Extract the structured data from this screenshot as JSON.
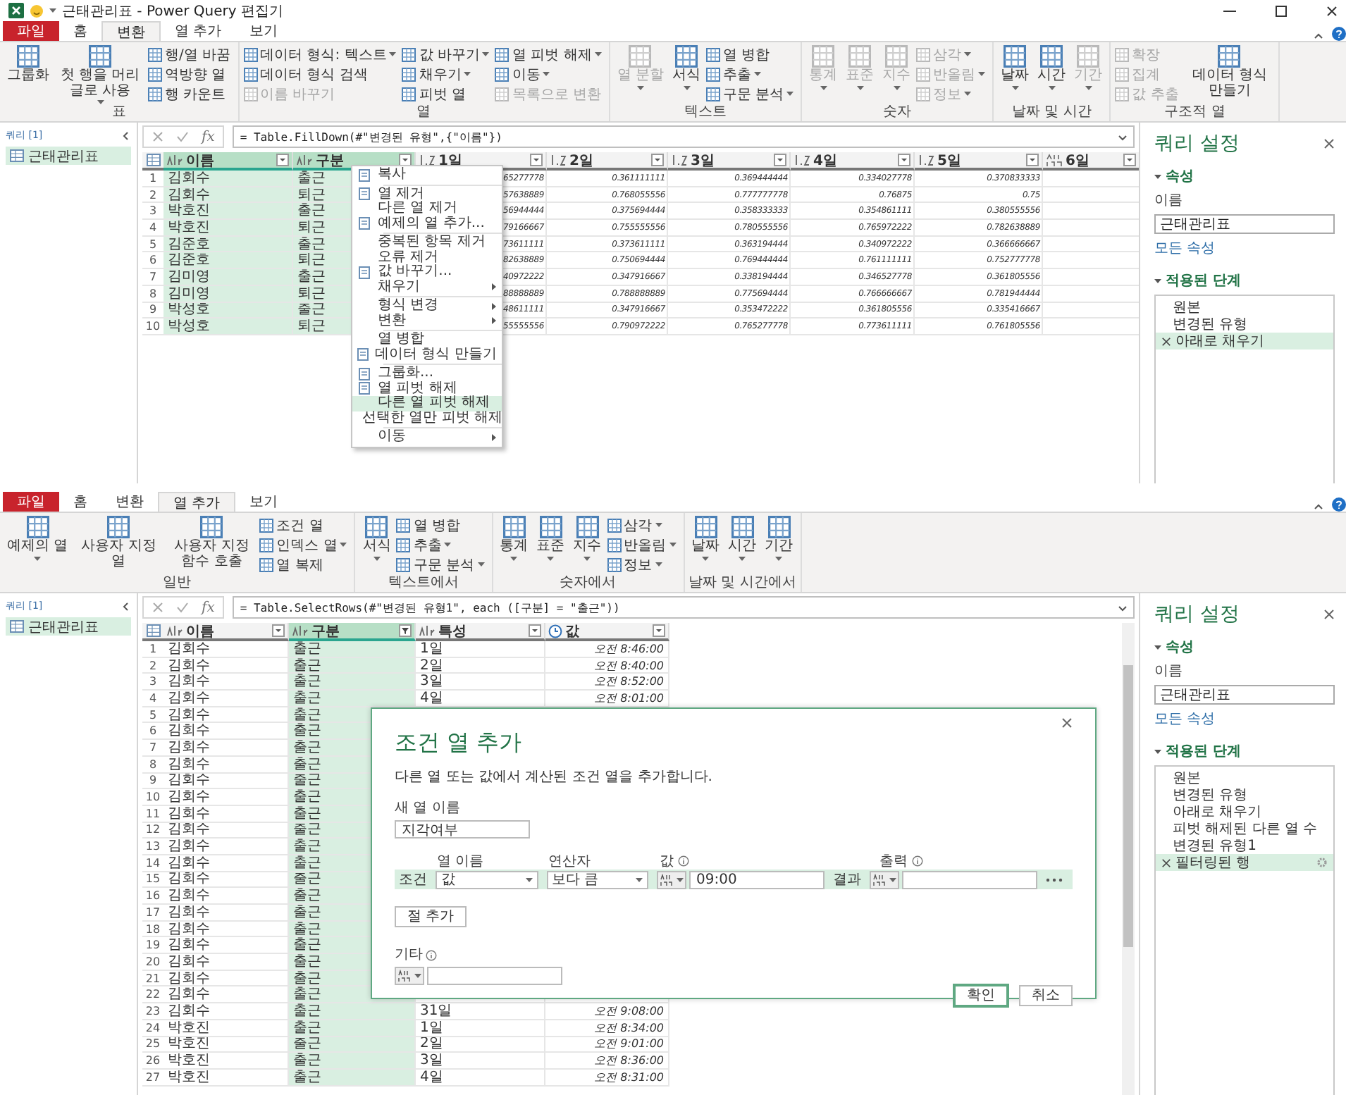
{
  "window": {
    "title": "근태관리표 - Power Query 편집기"
  },
  "editors": [
    {
      "ribbon_tabs": [
        {
          "label": "파일",
          "kind": "file",
          "selected": false
        },
        {
          "label": "홈",
          "kind": "tab",
          "selected": false
        },
        {
          "label": "변환",
          "kind": "tab",
          "selected": true
        },
        {
          "label": "열 추가",
          "kind": "tab",
          "selected": false
        },
        {
          "label": "보기",
          "kind": "tab",
          "selected": false
        }
      ],
      "ribbon_groups": [
        {
          "label": "표",
          "items": [
            {
              "label": "그룹화",
              "kind": "big",
              "disabled": false,
              "dropdown": false
            },
            {
              "label": "첫 행을 머리글로 사용",
              "kind": "big",
              "disabled": false,
              "dropdown": true
            },
            {
              "label": "행/열 바꿈",
              "kind": "small",
              "disabled": false,
              "dropdown": false
            },
            {
              "label": "역방향 열",
              "kind": "small",
              "disabled": false,
              "dropdown": false
            },
            {
              "label": "행 카운트",
              "kind": "small",
              "disabled": false,
              "dropdown": false
            }
          ]
        },
        {
          "label": "열",
          "items": [
            {
              "label": "데이터 형식: 텍스트",
              "kind": "small",
              "disabled": false,
              "dropdown": true
            },
            {
              "label": "데이터 형식 검색",
              "kind": "small",
              "disabled": false,
              "dropdown": false
            },
            {
              "label": "이름 바꾸기",
              "kind": "small",
              "disabled": true,
              "dropdown": false
            },
            {
              "label": "값 바꾸기",
              "kind": "small",
              "disabled": false,
              "dropdown": true
            },
            {
              "label": "채우기",
              "kind": "small",
              "disabled": false,
              "dropdown": true
            },
            {
              "label": "피벗 열",
              "kind": "small",
              "disabled": false,
              "dropdown": false
            },
            {
              "label": "열 피벗 해제",
              "kind": "small",
              "disabled": false,
              "dropdown": true
            },
            {
              "label": "이동",
              "kind": "small",
              "disabled": false,
              "dropdown": true
            },
            {
              "label": "목록으로 변환",
              "kind": "small",
              "disabled": true,
              "dropdown": false
            }
          ]
        },
        {
          "label": "텍스트",
          "items": [
            {
              "label": "열 분할",
              "kind": "big",
              "disabled": true,
              "dropdown": true
            },
            {
              "label": "서식",
              "kind": "big",
              "disabled": false,
              "dropdown": true
            },
            {
              "label": "열 병합",
              "kind": "small",
              "disabled": false,
              "dropdown": false
            },
            {
              "label": "추출",
              "kind": "small",
              "disabled": false,
              "dropdown": true
            },
            {
              "label": "구문 분석",
              "kind": "small",
              "disabled": false,
              "dropdown": true
            }
          ]
        },
        {
          "label": "숫자",
          "items": [
            {
              "label": "통계",
              "kind": "big",
              "disabled": true,
              "dropdown": true
            },
            {
              "label": "표준",
              "kind": "big",
              "disabled": true,
              "dropdown": true
            },
            {
              "label": "지수",
              "kind": "big",
              "disabled": true,
              "dropdown": true
            },
            {
              "label": "삼각",
              "kind": "small",
              "disabled": true,
              "dropdown": true
            },
            {
              "label": "반올림",
              "kind": "small",
              "disabled": true,
              "dropdown": true
            },
            {
              "label": "정보",
              "kind": "small",
              "disabled": true,
              "dropdown": true
            }
          ]
        },
        {
          "label": "날짜 및 시간",
          "items": [
            {
              "label": "날짜",
              "kind": "big",
              "disabled": false,
              "dropdown": true
            },
            {
              "label": "시간",
              "kind": "big",
              "disabled": false,
              "dropdown": true
            },
            {
              "label": "기간",
              "kind": "big",
              "disabled": true,
              "dropdown": true
            }
          ]
        },
        {
          "label": "구조적 열",
          "items": [
            {
              "label": "확장",
              "kind": "small",
              "disabled": true,
              "dropdown": false
            },
            {
              "label": "집계",
              "kind": "small",
              "disabled": true,
              "dropdown": false
            },
            {
              "label": "값 추출",
              "kind": "small",
              "disabled": true,
              "dropdown": false
            },
            {
              "label": "데이터 형식 만들기",
              "kind": "big",
              "disabled": false,
              "dropdown": false
            }
          ]
        }
      ],
      "queries": {
        "header": "쿼리 [1]",
        "items": [
          {
            "label": "근태관리표",
            "selected": true
          }
        ]
      },
      "function_label": "fx",
      "formula": "= Table.FillDown(#\"변경된 유형\",{\"이름\"})",
      "table": {
        "columns": [
          {
            "label": "이름",
            "kind": "text",
            "selected": true,
            "filtered": false
          },
          {
            "label": "구분",
            "kind": "text",
            "selected": true,
            "filtered": false
          },
          {
            "label": "1일",
            "kind": "number",
            "selected": false,
            "filtered": false
          },
          {
            "label": "2일",
            "kind": "number",
            "selected": false,
            "filtered": false
          },
          {
            "label": "3일",
            "kind": "number",
            "selected": false,
            "filtered": false
          },
          {
            "label": "4일",
            "kind": "number",
            "selected": false,
            "filtered": false
          },
          {
            "label": "5일",
            "kind": "number",
            "selected": false,
            "filtered": false
          },
          {
            "label": "6일",
            "kind": "any",
            "selected": false,
            "filtered": false
          }
        ],
        "rows": [
          {
            "n": "1",
            "cells": [
              "김회수",
              "출근",
              "65277778",
              "0.361111111",
              "0.369444444",
              "0.334027778",
              "0.370833333"
            ]
          },
          {
            "n": "2",
            "cells": [
              "김회수",
              "퇴근",
              "57638889",
              "0.768055556",
              "0.777777778",
              "0.76875",
              "0.75"
            ]
          },
          {
            "n": "3",
            "cells": [
              "박호진",
              "출근",
              "56944444",
              "0.375694444",
              "0.358333333",
              "0.354861111",
              "0.380555556"
            ]
          },
          {
            "n": "4",
            "cells": [
              "박호진",
              "퇴근",
              "79166667",
              "0.755555556",
              "0.780555556",
              "0.765972222",
              "0.782638889"
            ]
          },
          {
            "n": "5",
            "cells": [
              "김준호",
              "출근",
              "73611111",
              "0.373611111",
              "0.363194444",
              "0.340972222",
              "0.366666667"
            ]
          },
          {
            "n": "6",
            "cells": [
              "김준호",
              "퇴근",
              "82638889",
              "0.750694444",
              "0.769444444",
              "0.761111111",
              "0.752777778"
            ]
          },
          {
            "n": "7",
            "cells": [
              "김미영",
              "출근",
              "40972222",
              "0.347916667",
              "0.338194444",
              "0.346527778",
              "0.361805556"
            ]
          },
          {
            "n": "8",
            "cells": [
              "김미영",
              "퇴근",
              "88888889",
              "0.788888889",
              "0.775694444",
              "0.766666667",
              "0.781944444"
            ]
          },
          {
            "n": "9",
            "cells": [
              "박성호",
              "출근",
              "48611111",
              "0.347916667",
              "0.353472222",
              "0.361805556",
              "0.335416667"
            ]
          },
          {
            "n": "10",
            "cells": [
              "박성호",
              "퇴근",
              "55555556",
              "0.790972222",
              "0.765277778",
              "0.773611111",
              "0.761805556"
            ]
          }
        ]
      },
      "settings": {
        "title": "쿼리 설정",
        "properties_label": "속성",
        "name_label": "이름",
        "name_value": "근태관리표",
        "all_properties_link": "모든 속성",
        "steps_label": "적용된 단계",
        "steps": [
          {
            "label": "원본",
            "selected": false,
            "gear": false
          },
          {
            "label": "변경된 유형",
            "selected": false,
            "gear": false
          },
          {
            "label": "아래로 채우기",
            "selected": true,
            "gear": false
          }
        ]
      }
    },
    {
      "ribbon_tabs": [
        {
          "label": "파일",
          "kind": "file",
          "selected": false
        },
        {
          "label": "홈",
          "kind": "tab",
          "selected": false
        },
        {
          "label": "변환",
          "kind": "tab",
          "selected": false
        },
        {
          "label": "열 추가",
          "kind": "tab",
          "selected": true
        },
        {
          "label": "보기",
          "kind": "tab",
          "selected": false
        }
      ],
      "ribbon_groups": [
        {
          "label": "일반",
          "items": [
            {
              "label": "예제의 열",
              "kind": "big",
              "disabled": false,
              "dropdown": true
            },
            {
              "label": "사용자 지정 열",
              "kind": "big",
              "disabled": false,
              "dropdown": false
            },
            {
              "label": "사용자 지정 함수 호출",
              "kind": "big",
              "disabled": false,
              "dropdown": false
            },
            {
              "label": "조건 열",
              "kind": "small",
              "disabled": false,
              "dropdown": false
            },
            {
              "label": "인덱스 열",
              "kind": "small",
              "disabled": false,
              "dropdown": true
            },
            {
              "label": "열 복제",
              "kind": "small",
              "disabled": false,
              "dropdown": false
            }
          ]
        },
        {
          "label": "텍스트에서",
          "items": [
            {
              "label": "서식",
              "kind": "big",
              "disabled": false,
              "dropdown": true
            },
            {
              "label": "열 병합",
              "kind": "small",
              "disabled": false,
              "dropdown": false
            },
            {
              "label": "추출",
              "kind": "small",
              "disabled": false,
              "dropdown": true
            },
            {
              "label": "구문 분석",
              "kind": "small",
              "disabled": false,
              "dropdown": true
            }
          ]
        },
        {
          "label": "숫자에서",
          "items": [
            {
              "label": "통계",
              "kind": "big",
              "disabled": false,
              "dropdown": true
            },
            {
              "label": "표준",
              "kind": "big",
              "disabled": false,
              "dropdown": true
            },
            {
              "label": "지수",
              "kind": "big",
              "disabled": false,
              "dropdown": true
            },
            {
              "label": "삼각",
              "kind": "small",
              "disabled": false,
              "dropdown": true
            },
            {
              "label": "반올림",
              "kind": "small",
              "disabled": false,
              "dropdown": true
            },
            {
              "label": "정보",
              "kind": "small",
              "disabled": false,
              "dropdown": true
            }
          ]
        },
        {
          "label": "날짜 및 시간에서",
          "items": [
            {
              "label": "날짜",
              "kind": "big",
              "disabled": false,
              "dropdown": true
            },
            {
              "label": "시간",
              "kind": "big",
              "disabled": false,
              "dropdown": true
            },
            {
              "label": "기간",
              "kind": "big",
              "disabled": false,
              "dropdown": true
            }
          ]
        }
      ],
      "queries": {
        "header": "쿼리 [1]",
        "items": [
          {
            "label": "근태관리표",
            "selected": true
          }
        ]
      },
      "function_label": "fx",
      "formula": "= Table.SelectRows(#\"변경된 유형1\", each ([구분] = \"출근\"))",
      "table": {
        "columns": [
          {
            "label": "이름",
            "kind": "text",
            "selected": false,
            "filtered": false
          },
          {
            "label": "구분",
            "kind": "text",
            "selected": true,
            "filtered": true
          },
          {
            "label": "특성",
            "kind": "text",
            "selected": false,
            "filtered": false
          },
          {
            "label": "값",
            "kind": "time",
            "selected": false,
            "filtered": false
          }
        ],
        "rows": [
          {
            "n": "1",
            "cells": [
              "김회수",
              "출근",
              "1일",
              "오전 8:46:00"
            ]
          },
          {
            "n": "2",
            "cells": [
              "김회수",
              "출근",
              "2일",
              "오전 8:40:00"
            ]
          },
          {
            "n": "3",
            "cells": [
              "김회수",
              "출근",
              "3일",
              "오전 8:52:00"
            ]
          },
          {
            "n": "4",
            "cells": [
              "김회수",
              "출근",
              "4일",
              "오전 8:01:00"
            ]
          },
          {
            "n": "5",
            "cells": [
              "김회수",
              "출근"
            ]
          },
          {
            "n": "6",
            "cells": [
              "김회수",
              "출근"
            ]
          },
          {
            "n": "7",
            "cells": [
              "김회수",
              "출근"
            ]
          },
          {
            "n": "8",
            "cells": [
              "김회수",
              "출근"
            ]
          },
          {
            "n": "9",
            "cells": [
              "김회수",
              "출근"
            ]
          },
          {
            "n": "10",
            "cells": [
              "김회수",
              "출근"
            ]
          },
          {
            "n": "11",
            "cells": [
              "김회수",
              "출근"
            ]
          },
          {
            "n": "12",
            "cells": [
              "김회수",
              "출근"
            ]
          },
          {
            "n": "13",
            "cells": [
              "김회수",
              "출근"
            ]
          },
          {
            "n": "14",
            "cells": [
              "김회수",
              "출근"
            ]
          },
          {
            "n": "15",
            "cells": [
              "김회수",
              "출근"
            ]
          },
          {
            "n": "16",
            "cells": [
              "김회수",
              "출근"
            ]
          },
          {
            "n": "17",
            "cells": [
              "김회수",
              "출근"
            ]
          },
          {
            "n": "18",
            "cells": [
              "김회수",
              "출근"
            ]
          },
          {
            "n": "19",
            "cells": [
              "김회수",
              "출근"
            ]
          },
          {
            "n": "20",
            "cells": [
              "김회수",
              "출근"
            ]
          },
          {
            "n": "21",
            "cells": [
              "김회수",
              "출근"
            ]
          },
          {
            "n": "22",
            "cells": [
              "김회수",
              "출근"
            ]
          },
          {
            "n": "23",
            "cells": [
              "김회수",
              "출근",
              "31일",
              "오전 9:08:00"
            ]
          },
          {
            "n": "24",
            "cells": [
              "박호진",
              "출근",
              "1일",
              "오전 8:34:00"
            ]
          },
          {
            "n": "25",
            "cells": [
              "박호진",
              "출근",
              "2일",
              "오전 9:01:00"
            ]
          },
          {
            "n": "26",
            "cells": [
              "박호진",
              "출근",
              "3일",
              "오전 8:36:00"
            ]
          },
          {
            "n": "27",
            "cells": [
              "박호진",
              "출근",
              "4일",
              "오전 8:31:00"
            ]
          }
        ]
      },
      "settings": {
        "title": "쿼리 설정",
        "properties_label": "속성",
        "name_label": "이름",
        "name_value": "근태관리표",
        "all_properties_link": "모든 속성",
        "steps_label": "적용된 단계",
        "steps": [
          {
            "label": "원본",
            "selected": false,
            "gear": false
          },
          {
            "label": "변경된 유형",
            "selected": false,
            "gear": false
          },
          {
            "label": "아래로 채우기",
            "selected": false,
            "gear": false
          },
          {
            "label": "피벗 해제된 다른 열 수",
            "selected": false,
            "gear": false
          },
          {
            "label": "변경된 유형1",
            "selected": false,
            "gear": false
          },
          {
            "label": "필터링된 행",
            "selected": true,
            "gear": true
          }
        ]
      }
    }
  ],
  "context_menu": [
    [
      {
        "label": "복사",
        "icon": true,
        "submenu": false,
        "selected": false
      }
    ],
    [
      {
        "label": "열 제거",
        "icon": true,
        "submenu": false,
        "selected": false
      },
      {
        "label": "다른 열 제거",
        "icon": false,
        "submenu": false,
        "selected": false
      },
      {
        "label": "예제의 열 추가...",
        "icon": true,
        "submenu": false,
        "selected": false
      }
    ],
    [
      {
        "label": "중복된 항목 제거",
        "icon": false,
        "submenu": false,
        "selected": false
      },
      {
        "label": "오류 제거",
        "icon": false,
        "submenu": false,
        "selected": false
      },
      {
        "label": "값 바꾸기...",
        "icon": true,
        "submenu": false,
        "selected": false
      },
      {
        "label": "채우기",
        "icon": false,
        "submenu": true,
        "selected": false
      }
    ],
    [
      {
        "label": "형식 변경",
        "icon": false,
        "submenu": true,
        "selected": false
      },
      {
        "label": "변환",
        "icon": false,
        "submenu": true,
        "selected": false
      }
    ],
    [
      {
        "label": "열 병합",
        "icon": false,
        "submenu": false,
        "selected": false
      },
      {
        "label": "데이터 형식 만들기",
        "icon": true,
        "submenu": false,
        "selected": false
      }
    ],
    [
      {
        "label": "그룹화...",
        "icon": true,
        "submenu": false,
        "selected": false
      },
      {
        "label": "열 피벗 해제",
        "icon": true,
        "submenu": false,
        "selected": false
      },
      {
        "label": "다른 열 피벗 해제",
        "icon": false,
        "submenu": false,
        "selected": true
      },
      {
        "label": "선택한 열만 피벗 해제",
        "icon": false,
        "submenu": false,
        "selected": false
      }
    ],
    [
      {
        "label": "이동",
        "icon": false,
        "submenu": true,
        "selected": false
      }
    ]
  ],
  "dialog": {
    "title": "조건 열 추가",
    "description": "다른 열 또는 값에서 계산된 조건 열을 추가합니다.",
    "name_label": "새 열 이름",
    "name_value": "지각여부",
    "headers": {
      "column": "열 이름",
      "operator": "연산자",
      "value": "값",
      "output": "출력"
    },
    "clauses": [
      {
        "label": "조건",
        "column": "값",
        "operator": "보다 큼",
        "value": "09:00",
        "result_label": "결과"
      }
    ],
    "add_clause": "절 추가",
    "else_label": "기타",
    "ok": "확인",
    "cancel": "취소"
  }
}
